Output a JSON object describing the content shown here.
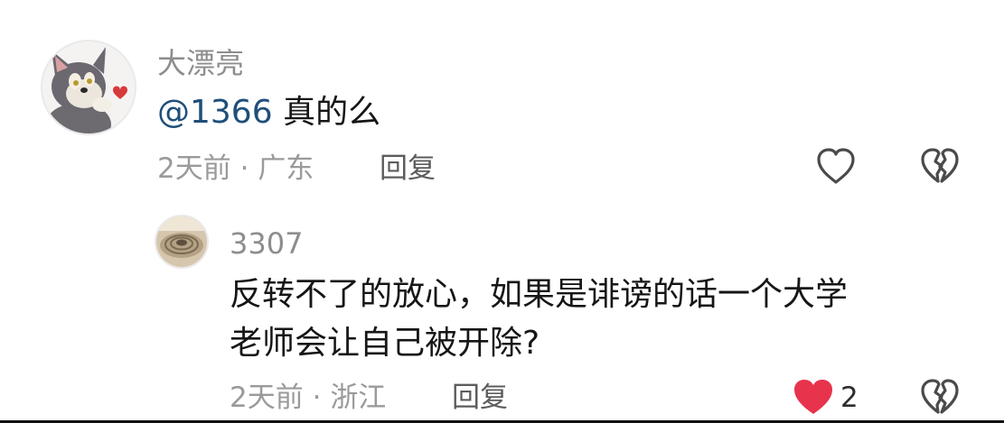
{
  "comments": [
    {
      "username": "大漂亮",
      "mention": "@1366",
      "text": " 真的么",
      "time": "2天前",
      "separator": "·",
      "location": "广东",
      "reply_label": "回复",
      "liked": false
    }
  ],
  "reply": {
    "username": "3307",
    "text_line1": "反转不了的放心，如果是诽谤的话一个大学",
    "text_line2": "老师会让自己被开除?",
    "time": "2天前",
    "separator": "·",
    "location": "浙江",
    "reply_label": "回复",
    "liked": true,
    "like_count": "2"
  },
  "colors": {
    "like_active": "#e8334d",
    "mention": "#1f4f7a"
  },
  "icons": {
    "like": "heart-outline-icon",
    "like_active": "heart-filled-icon",
    "dislike": "broken-heart-icon"
  }
}
